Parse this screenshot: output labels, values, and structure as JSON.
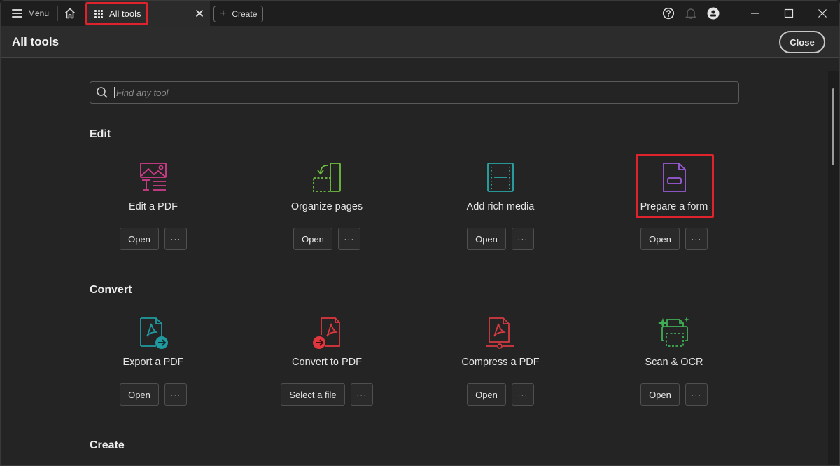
{
  "titlebar": {
    "menu_label": "Menu",
    "active_tab_label": "All tools",
    "create_label": "Create",
    "icons": [
      "menu-icon",
      "home-icon",
      "apps-grid-icon",
      "close-tab-icon",
      "plus-icon",
      "help-icon",
      "bell-icon",
      "account-icon",
      "minimize-icon",
      "maximize-icon",
      "close-window-icon"
    ]
  },
  "header": {
    "title": "All tools",
    "close_label": "Close"
  },
  "search": {
    "placeholder": "Find any tool",
    "value": ""
  },
  "sections": [
    {
      "title": "Edit",
      "tools": [
        {
          "name": "Edit a PDF",
          "icon": "edit-pdf-icon",
          "color": "#d23c8c",
          "primary": "Open",
          "more": "···"
        },
        {
          "name": "Organize pages",
          "icon": "organize-pages-icon",
          "color": "#6fbf3f",
          "primary": "Open",
          "more": "···"
        },
        {
          "name": "Add rich media",
          "icon": "rich-media-icon",
          "color": "#2aa7a7",
          "primary": "Open",
          "more": "···"
        },
        {
          "name": "Prepare a form",
          "icon": "prepare-form-icon",
          "color": "#9a5bd6",
          "primary": "Open",
          "more": "···",
          "highlighted": true
        }
      ]
    },
    {
      "title": "Convert",
      "tools": [
        {
          "name": "Export a PDF",
          "icon": "export-pdf-icon",
          "color": "#1f9aa0",
          "primary": "Open",
          "more": "···"
        },
        {
          "name": "Convert to PDF",
          "icon": "convert-to-pdf-icon",
          "color": "#e0363d",
          "primary": "Select a file",
          "more": "···"
        },
        {
          "name": "Compress a PDF",
          "icon": "compress-pdf-icon",
          "color": "#d43a40",
          "primary": "Open",
          "more": "···"
        },
        {
          "name": "Scan & OCR",
          "icon": "scan-ocr-icon",
          "color": "#3fae55",
          "primary": "Open",
          "more": "···"
        }
      ]
    },
    {
      "title": "Create",
      "tools": []
    }
  ],
  "colors": {
    "highlight": "#e0222d",
    "background": "#242424",
    "header": "#2c2c2c"
  }
}
